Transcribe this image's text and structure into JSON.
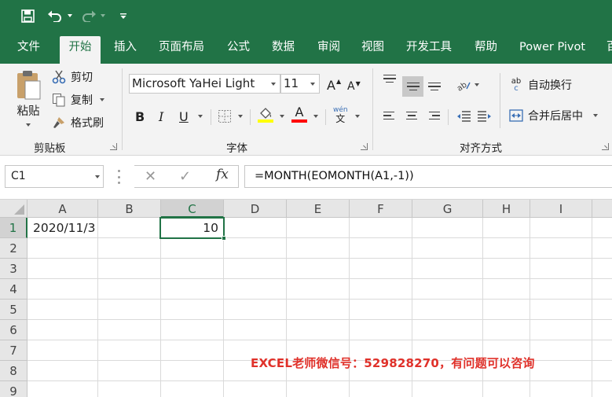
{
  "tabs": [
    "文件",
    "开始",
    "插入",
    "页面布局",
    "公式",
    "数据",
    "审阅",
    "视图",
    "开发工具",
    "帮助",
    "Power Pivot",
    "百"
  ],
  "active_tab": "开始",
  "clipboard": {
    "paste_label": "粘贴",
    "cut_label": "剪切",
    "copy_label": "复制",
    "format_painter_label": "格式刷",
    "group_label": "剪贴板"
  },
  "font": {
    "font_name": "Microsoft YaHei Light",
    "font_size": "11",
    "bold": "B",
    "italic": "I",
    "underline": "U",
    "grow_font": "A",
    "shrink_font": "A",
    "phonetic": "wén",
    "phonetic_sub": "文",
    "group_label": "字体",
    "fill_color": "#ffff00",
    "font_color": "#ff0000"
  },
  "alignment": {
    "wrap_text_label": "自动换行",
    "merge_center_label": "合并后居中",
    "wrap_icon_text": "ab",
    "wrap_icon_sub": "c",
    "group_label": "对齐方式"
  },
  "formula_bar": {
    "name_box": "C1",
    "cancel_icon": "✕",
    "enter_icon": "✓",
    "fx_label": "fx",
    "formula": "=MONTH(EOMONTH(A1,-1))"
  },
  "columns": [
    "A",
    "B",
    "C",
    "D",
    "E",
    "F",
    "G",
    "H",
    "I"
  ],
  "rows": [
    "1",
    "2",
    "3",
    "4",
    "5",
    "6",
    "7",
    "8",
    "9"
  ],
  "cells": {
    "A1": "2020/11/3",
    "C1": "10"
  },
  "selected_cell": "C1",
  "watermark": "EXCEL老师微信号：529828270，有问题可以咨询",
  "colors": {
    "brand": "#217346",
    "watermark": "#e0312a"
  }
}
